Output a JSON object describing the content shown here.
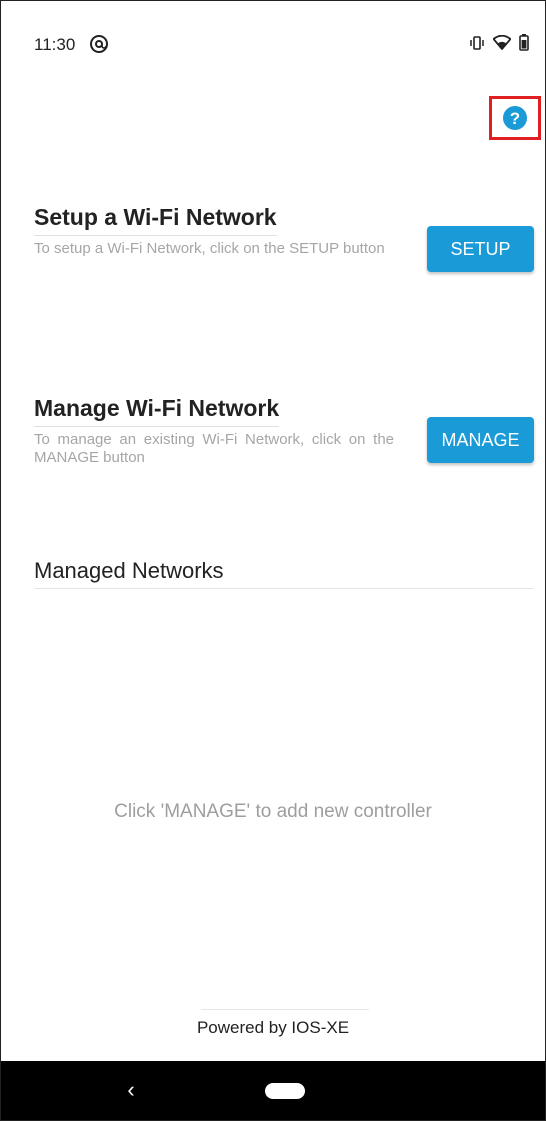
{
  "status_bar": {
    "time": "11:30",
    "app_icon": "at-sync-icon",
    "icons": [
      "vibrate-icon",
      "wifi-icon",
      "battery-icon"
    ]
  },
  "help": {
    "label": "?",
    "icon": "help-icon",
    "accent_color": "#1a9ad6",
    "highlight_color": "#e02020"
  },
  "setup_section": {
    "title": "Setup a Wi-Fi Network",
    "description": "To setup a Wi-Fi Network, click on the SETUP button",
    "button_label": "SETUP"
  },
  "manage_section": {
    "title": "Manage Wi-Fi Network",
    "description": "To manage an existing Wi-Fi Network, click on the MANAGE button",
    "button_label": "MANAGE"
  },
  "managed_networks": {
    "title": "Managed Networks",
    "empty_message": "Click 'MANAGE' to add new controller"
  },
  "footer": {
    "powered_by": "Powered by IOS-XE"
  },
  "nav_bar": {
    "back_label": "‹",
    "back_icon": "back-icon",
    "home_icon": "home-pill-icon"
  },
  "colors": {
    "button_bg": "#1a9ad6",
    "button_text": "#ffffff",
    "nav_bg": "#000000"
  }
}
